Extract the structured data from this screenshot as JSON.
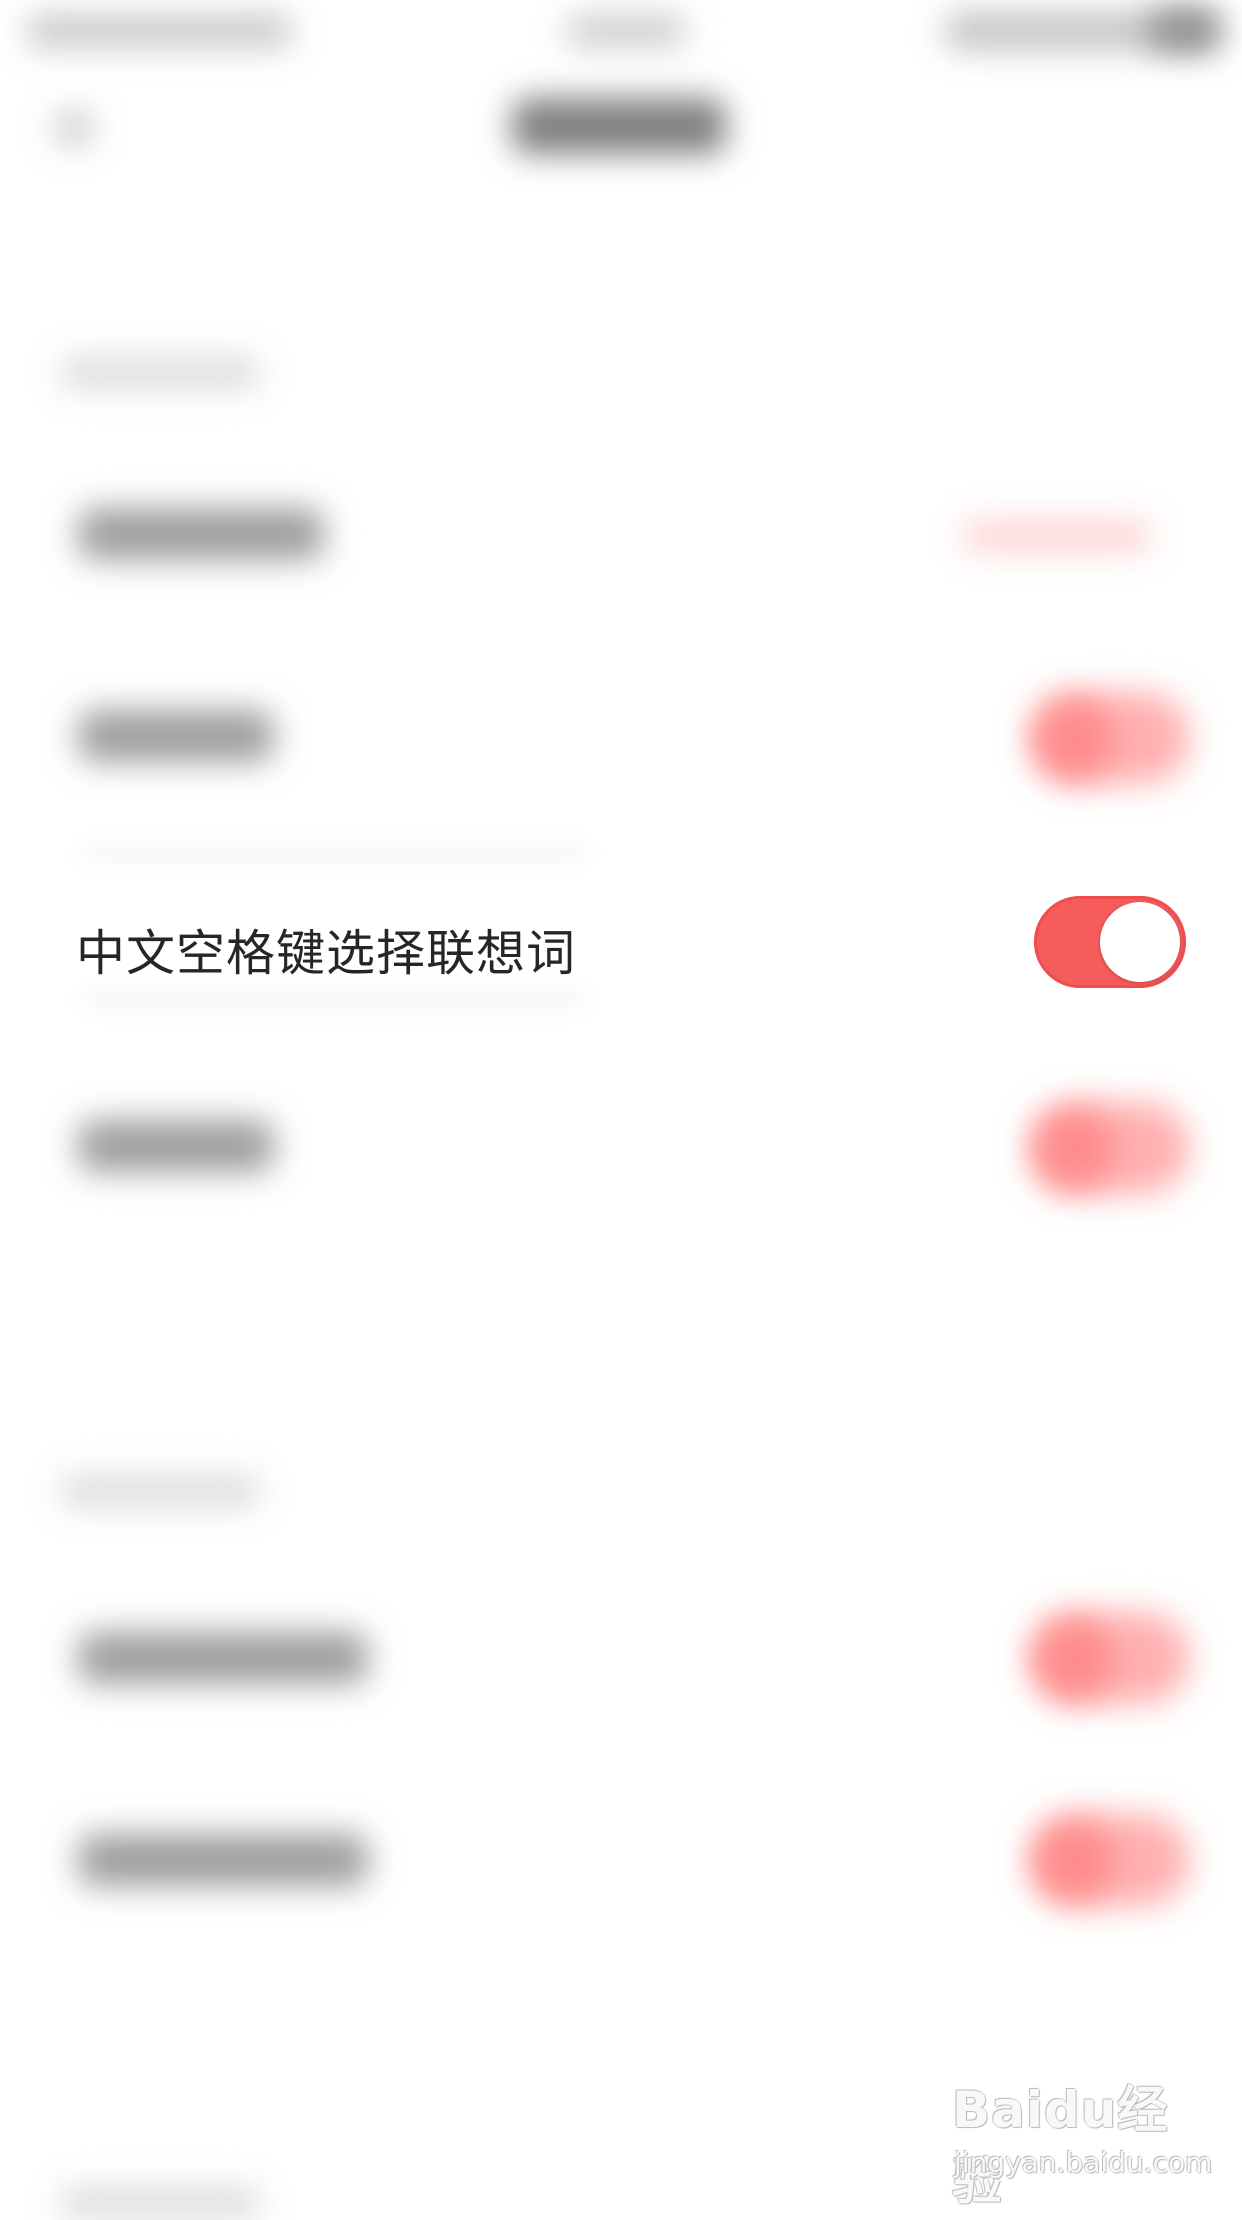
{
  "settings_row": {
    "label": "中文空格键选择联想词",
    "toggle_on": true,
    "accent_color": "#f75c5c"
  },
  "watermark": {
    "logo": "Baidu经验",
    "url": "jingyan.baidu.com"
  }
}
